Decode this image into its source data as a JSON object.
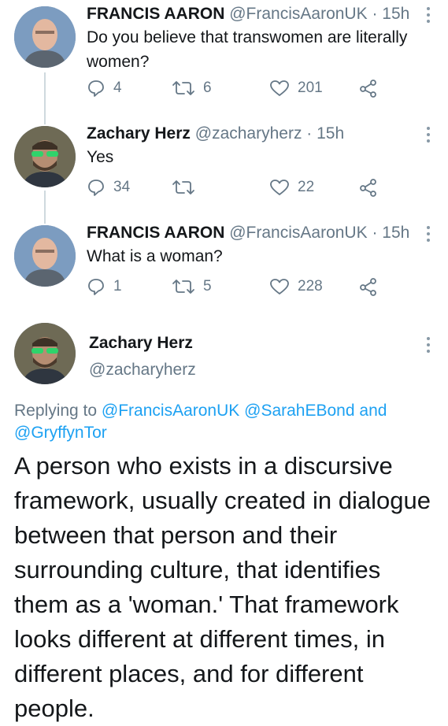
{
  "tweets": [
    {
      "name": "FRANCIS AARON",
      "handle": "@FrancisAaronUK · 15h",
      "text": "Do you believe that transwomen are literally women?",
      "replies": "4",
      "retweets": "6",
      "likes": "201"
    },
    {
      "name": "Zachary Herz",
      "handle": "@zacharyherz · 15h",
      "text": "Yes",
      "replies": "34",
      "retweets": "",
      "likes": "22"
    },
    {
      "name": "FRANCIS AARON",
      "handle": "@FrancisAaronUK · 15h",
      "text": "What is a woman?",
      "replies": "1",
      "retweets": "5",
      "likes": "228"
    }
  ],
  "main_tweet": {
    "name": "Zachary Herz",
    "handle": "@zacharyherz",
    "replying_prefix": "Replying to",
    "mention_1": "@FrancisAaronUK",
    "mention_2": "@SarahEBond",
    "and_word": "and",
    "mention_3": "@GryffynTor",
    "text": "A person who exists in a discursive framework, usually created in dialogue between that person and their surrounding culture, that identifies them as a 'woman.' That framework looks different at different times, in different places, and for different people."
  },
  "colors": {
    "link": "#1da1f2",
    "secondary": "#657786",
    "primary_text": "#14171a"
  },
  "icons": [
    "reply-icon",
    "retweet-icon",
    "like-icon",
    "share-icon",
    "more-options-icon"
  ]
}
